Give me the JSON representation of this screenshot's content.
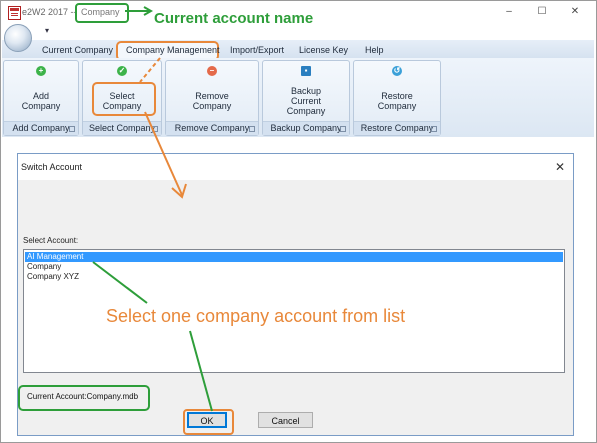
{
  "window": {
    "app_title": "e2W2 2017 --",
    "company_title": "Company",
    "buttons": {
      "minimize": "–",
      "maximize": "☐",
      "close": "✕"
    }
  },
  "annotations": {
    "current_account": "Current account name",
    "select_company": "Select one company account from list"
  },
  "qat": {
    "arrow": "▾"
  },
  "menu": {
    "items": [
      "Current Company",
      "Company Management",
      "Import/Export",
      "License Key",
      "Help"
    ]
  },
  "ribbon": {
    "groups": [
      {
        "label_lines": [
          "Add",
          "Company"
        ],
        "footer": "Add Company",
        "icon": "plus-icon",
        "icon_color": "#3db34a"
      },
      {
        "label_lines": [
          "Select",
          "Company"
        ],
        "footer": "Select Company",
        "icon": "check-icon",
        "icon_color": "#3db34a"
      },
      {
        "label_lines": [
          "Remove",
          "Company"
        ],
        "footer": "Remove Company",
        "icon": "minus-icon",
        "icon_color": "#e46a4a"
      },
      {
        "label_lines": [
          "Backup",
          "Current",
          "Company"
        ],
        "footer": "Backup Company",
        "icon": "floppy-icon",
        "icon_color": "#2a7fc0"
      },
      {
        "label_lines": [
          "Restore",
          "Company"
        ],
        "footer": "Restore Company",
        "icon": "restore-icon",
        "icon_color": "#3aa0d8"
      }
    ]
  },
  "dialog": {
    "title": "Switch Account",
    "close": "✕",
    "select_label": "Select Account:",
    "accounts": [
      "AI Management",
      "Company",
      "Company XYZ"
    ],
    "selected_index": 0,
    "current_account": "Current Account:Company.mdb",
    "ok_label": "OK",
    "cancel_label": "Cancel"
  },
  "colors": {
    "annotation_green": "#2e9e3a",
    "annotation_orange": "#e8883a",
    "selection": "#3399ff"
  }
}
